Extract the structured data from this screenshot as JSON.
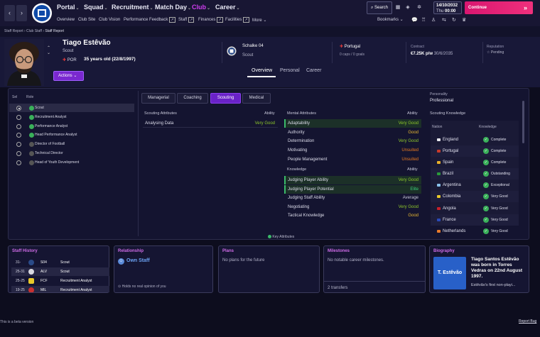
{
  "nav": {
    "back": "‹",
    "forward": "›",
    "main": [
      {
        "label": "Portal"
      },
      {
        "label": "Squad"
      },
      {
        "label": "Recruitment"
      },
      {
        "label": "Match Day"
      },
      {
        "label": "Club"
      },
      {
        "label": "Career"
      }
    ],
    "sub": [
      "Overview",
      "Club Site",
      "Club Vision",
      "Performance Feedback",
      "Staff",
      "Finances",
      "Facilities",
      "More"
    ],
    "search": "Search",
    "date": "14/10/2032",
    "day": "Thu",
    "time": "00:00",
    "continue": "Continue",
    "bookmarks": "Bookmarks"
  },
  "crumbs": [
    "Staff Report",
    "Club Staff",
    "Staff Report"
  ],
  "person": {
    "name": "Tiago Estêvão",
    "role": "Scout",
    "nat_code": "POR",
    "age": "35 years old (22/8/1997)",
    "actions": "Actions"
  },
  "club": {
    "name": "Schalke 04",
    "role": "Scout"
  },
  "nation": {
    "name": "Portugal",
    "caps": "0 caps / 0 goals"
  },
  "contract": {
    "label": "Contract",
    "value": "€7.25K p/w",
    "date": "30/6/2035"
  },
  "reputation": {
    "label": "Reputation",
    "value": "Pending"
  },
  "htabs": [
    "Overview",
    "Personal",
    "Career"
  ],
  "roles": {
    "head_sel": "Sel",
    "head_role": "Role",
    "items": [
      "Scout",
      "Recruitment Analyst",
      "Performance Analyst",
      "Head Performance Analyst",
      "Director of Football",
      "Technical Director",
      "Head of Youth Development"
    ]
  },
  "ptabs": [
    "Managerial",
    "Coaching",
    "Scouting",
    "Medical"
  ],
  "scouting": {
    "title": "Scouting Attributes",
    "ability": "Ability",
    "rows": [
      {
        "n": "Analysing Data",
        "v": "Very Good"
      }
    ]
  },
  "mental": {
    "title": "Mental Attributes",
    "ability": "Ability",
    "rows": [
      {
        "n": "Adaptability",
        "v": "Very Good"
      },
      {
        "n": "Authority",
        "v": "Good"
      },
      {
        "n": "Determination",
        "v": "Very Good"
      },
      {
        "n": "Motivating",
        "v": "Unsuited"
      },
      {
        "n": "People Management",
        "v": "Unsuited"
      }
    ]
  },
  "knowledge": {
    "title": "Knowledge",
    "ability": "Ability",
    "rows": [
      {
        "n": "Judging Player Ability",
        "v": "Very Good"
      },
      {
        "n": "Judging Player Potential",
        "v": "Elite"
      },
      {
        "n": "Judging Staff Ability",
        "v": "Average"
      },
      {
        "n": "Negotiating",
        "v": "Very Good"
      },
      {
        "n": "Tactical Knowledge",
        "v": "Good"
      }
    ]
  },
  "key_attr": "Key Attributes",
  "personality": {
    "label": "Personality",
    "value": "Professional"
  },
  "sk": {
    "title": "Scouting Knowledge",
    "col_nation": "Nation",
    "col_know": "Knowledge",
    "rows": [
      {
        "n": "England",
        "k": "Complete"
      },
      {
        "n": "Portugal",
        "k": "Complete"
      },
      {
        "n": "Spain",
        "k": "Complete"
      },
      {
        "n": "Brazil",
        "k": "Outstanding"
      },
      {
        "n": "Argentina",
        "k": "Exceptional"
      },
      {
        "n": "Colombia",
        "k": "Very Good"
      },
      {
        "n": "Angola",
        "k": "Very Good"
      },
      {
        "n": "France",
        "k": "Very Good"
      },
      {
        "n": "Netherlands",
        "k": "Very Good"
      }
    ]
  },
  "history": {
    "title": "Staff History",
    "rows": [
      {
        "y": "31-",
        "c": "S04",
        "r": "Scout"
      },
      {
        "y": "25-31",
        "c": "ALV",
        "r": "Scout"
      },
      {
        "y": "25-25",
        "c": "FCF",
        "r": "Recruitment Analyst"
      },
      {
        "y": "19-25",
        "c": "MIL",
        "r": "Recruitment Analyst"
      }
    ]
  },
  "relationship": {
    "title": "Relationship",
    "value": "Own Staff",
    "note": "Holds no real opinion of you"
  },
  "plans": {
    "title": "Plans",
    "text": "No plans for the future"
  },
  "milestones": {
    "title": "Milestones",
    "text": "No notable career milestones.",
    "transfers": "2 transfers"
  },
  "bio": {
    "title": "Biography",
    "card": "T. Estêvão",
    "text": "Tiago Santos Estêvão was born in Torres Vedras on 22nd August 1997.",
    "more": "Estêvão's first non-playi..."
  },
  "footer": {
    "beta": "This is a beta version",
    "report": "Report Bug"
  }
}
